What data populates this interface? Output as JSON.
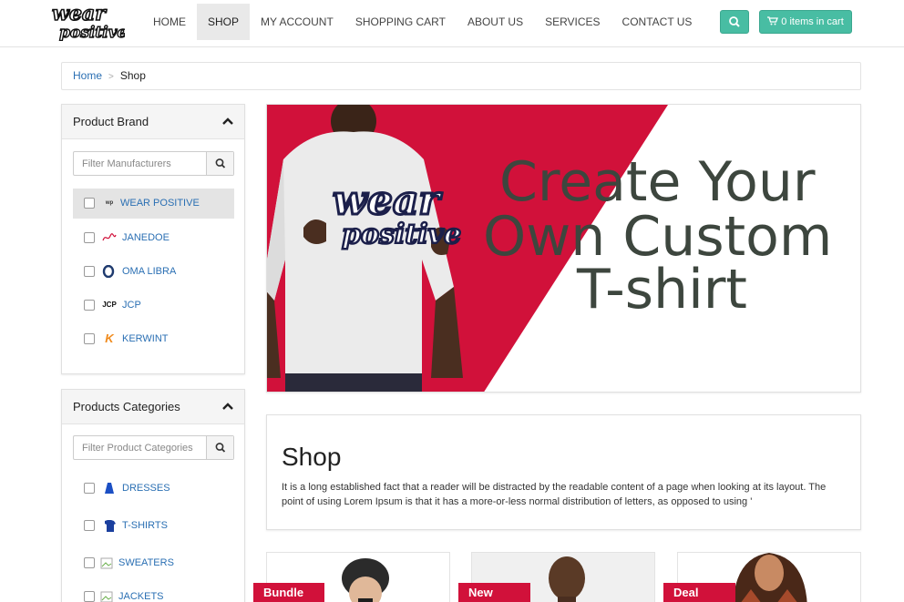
{
  "header": {
    "logo_text": "wear positive",
    "nav": [
      {
        "label": "HOME",
        "active": false
      },
      {
        "label": "SHOP",
        "active": true
      },
      {
        "label": "MY ACCOUNT",
        "active": false
      },
      {
        "label": "SHOPPING CART",
        "active": false
      },
      {
        "label": "ABOUT US",
        "active": false
      },
      {
        "label": "SERVICES",
        "active": false
      },
      {
        "label": "CONTACT US",
        "active": false
      }
    ],
    "cart_label": "0 items in cart",
    "search_icon": "search-icon",
    "cart_icon": "cart-icon"
  },
  "breadcrumb": {
    "home": "Home",
    "separator": ">",
    "current": "Shop"
  },
  "brands_panel": {
    "title": "Product Brand",
    "filter_placeholder": "Filter Manufacturers",
    "items": [
      {
        "label": "WEAR POSITIVE",
        "selected": true
      },
      {
        "label": "JANEDOE",
        "selected": false
      },
      {
        "label": "OMA LIBRA",
        "selected": false
      },
      {
        "label": "JCP",
        "selected": false,
        "icon_text": "JCP"
      },
      {
        "label": "KERWINT",
        "selected": false,
        "icon_text": "K"
      }
    ]
  },
  "categories_panel": {
    "title": "Products Categories",
    "filter_placeholder": "Filter Product Categories",
    "items": [
      {
        "label": "DRESSES"
      },
      {
        "label": "T-SHIRTS"
      },
      {
        "label": "SWEATERS"
      },
      {
        "label": "JACKETS"
      }
    ]
  },
  "banner": {
    "line1": "Create Your",
    "line2": "Own Custom",
    "line3": "T-shirt",
    "shirt_print_line1": "wear",
    "shirt_print_line2": "positive",
    "accent_color": "#d1113a",
    "text_color": "#3d463e"
  },
  "shop_intro": {
    "title": "Shop",
    "text": "It is a long established fact that a reader will be distracted by the readable content of a page when looking at its layout. The point of using Lorem Ipsum is that it has a more-or-less normal distribution of letters, as opposed to using '"
  },
  "products": [
    {
      "badge": "Bundle"
    },
    {
      "badge": "New"
    },
    {
      "badge": "Deal"
    }
  ],
  "colors": {
    "accent_green": "#48bda3",
    "link_blue": "#2a6fb3",
    "badge_red": "#d1113a"
  }
}
